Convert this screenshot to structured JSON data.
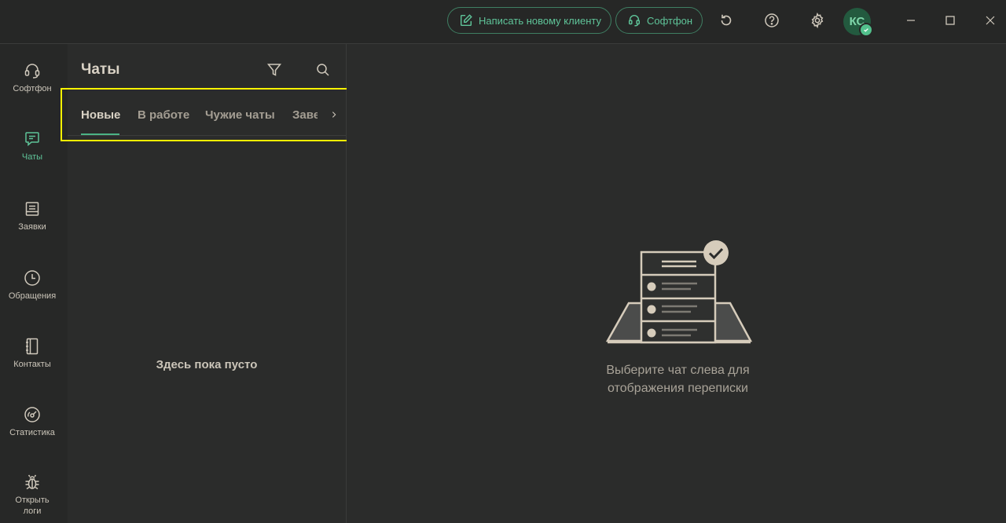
{
  "header": {
    "write_new_client_label": "Написать новому клиенту",
    "softphone_label": "Софтфон",
    "avatar_initials": "КС"
  },
  "sidebar": {
    "items": [
      {
        "label": "Софтфон",
        "icon": "headset-icon"
      },
      {
        "label": "Чаты",
        "icon": "chat-icon",
        "active": true
      },
      {
        "label": "Заявки",
        "icon": "requests-icon"
      },
      {
        "label": "Обращения",
        "icon": "clock-icon"
      },
      {
        "label": "Контакты",
        "icon": "contacts-book-icon"
      },
      {
        "label": "Статистика",
        "icon": "statistics-gauge-icon"
      },
      {
        "label": "Открыть логи",
        "icon": "bug-icon"
      }
    ]
  },
  "chats": {
    "title": "Чаты",
    "tabs": [
      "Новые",
      "В работе",
      "Чужие чаты",
      "Завершенные"
    ],
    "active_tab": "Новые",
    "empty_text": "Здесь пока пусто"
  },
  "main": {
    "hint": "Выберите чат слева для отображения переписки"
  },
  "colors": {
    "accent": "#5fc499",
    "background": "#2b2c2b",
    "highlight": "#fff300"
  }
}
